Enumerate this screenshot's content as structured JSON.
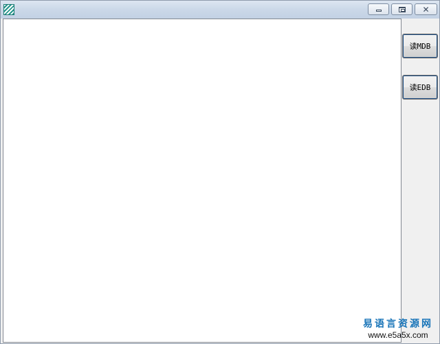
{
  "window": {
    "icon": "app-logo-icon",
    "controls": {
      "minimize": "minimize-icon",
      "maximize": "maximize-icon",
      "close": "close-icon",
      "close_glyph": "✕"
    }
  },
  "buttons": {
    "read_mdb": "读MDB",
    "read_edb": "读EDB"
  },
  "watermark": {
    "title": "易语言资源网",
    "url": "www.e5a5x.com"
  },
  "colors": {
    "titlebar": "#cbd8e8",
    "button_focus": "#1e4f86",
    "watermark_title": "#1874b8"
  }
}
